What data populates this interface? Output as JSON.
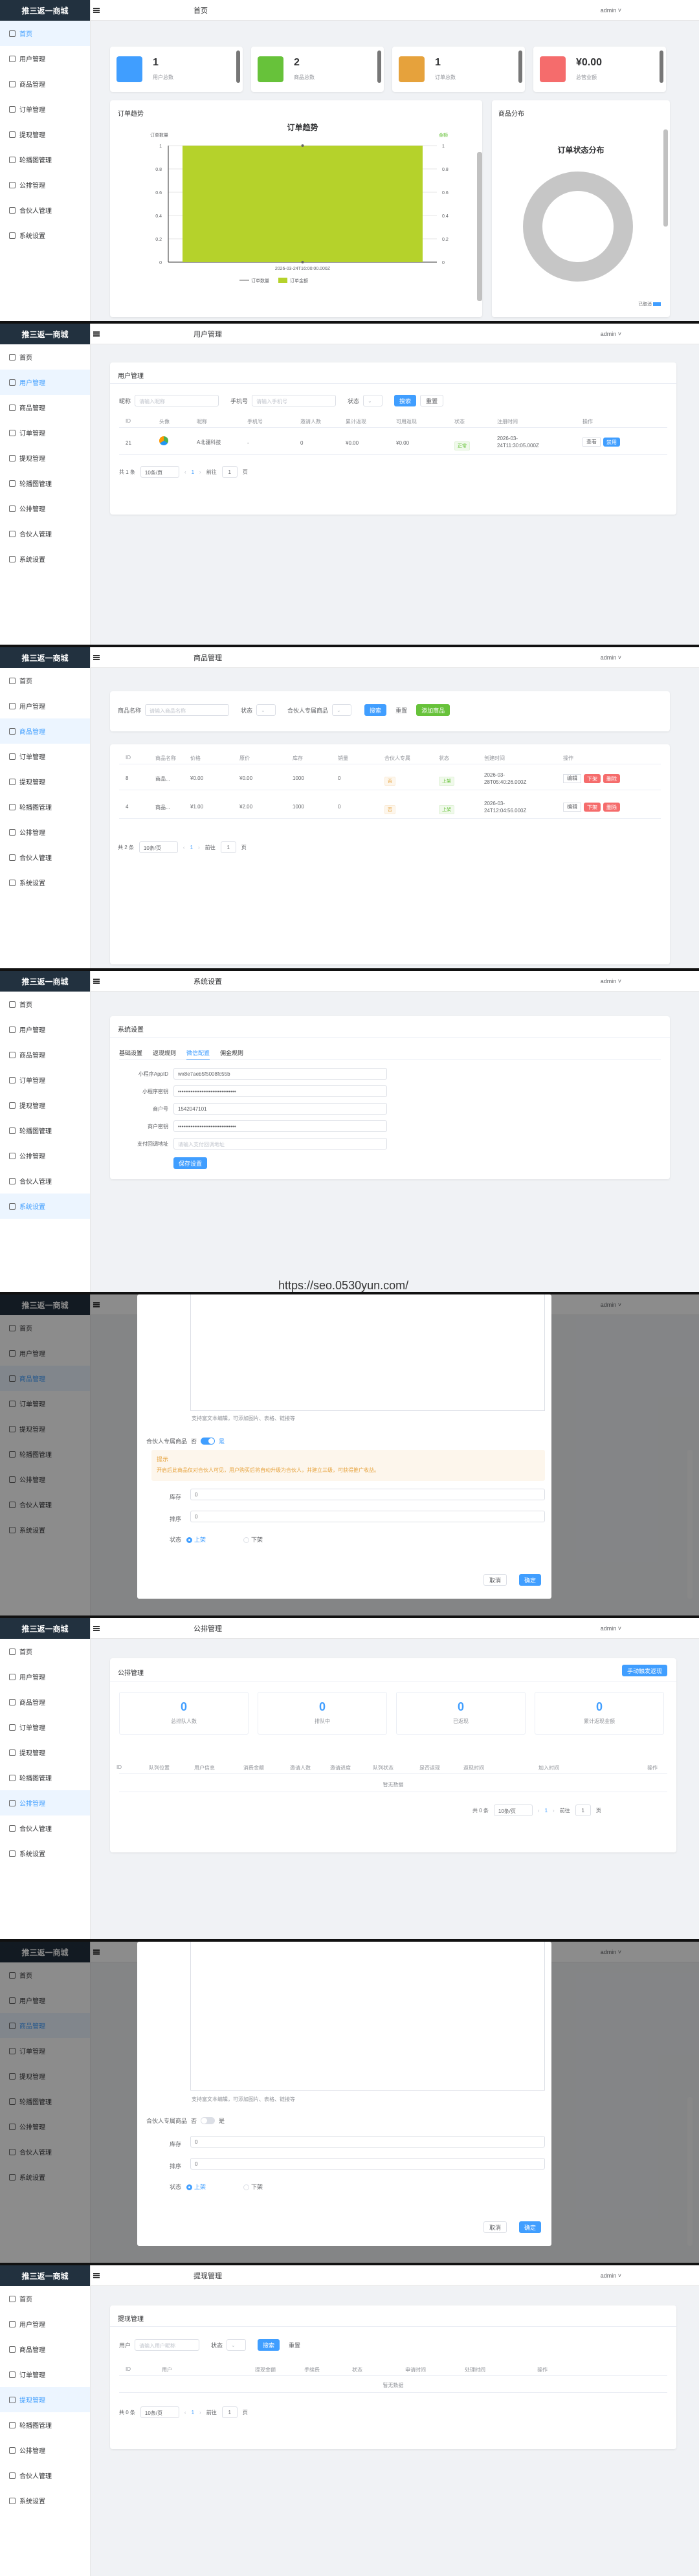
{
  "app": {
    "name": "推三返一商城",
    "user": "admin ˅"
  },
  "menu": [
    "首页",
    "用户管理",
    "商品管理",
    "订单管理",
    "提现管理",
    "轮播图管理",
    "公排管理",
    "合伙人管理",
    "系统设置"
  ],
  "s1": {
    "title": "首页",
    "stats": [
      {
        "value": "1",
        "label": "用户总数",
        "color": "#409eff"
      },
      {
        "value": "2",
        "label": "商品总数",
        "color": "#67c23a"
      },
      {
        "value": "1",
        "label": "订单总数",
        "color": "#e6a23c"
      },
      {
        "value": "¥0.00",
        "label": "总营业额",
        "color": "#f56c6c"
      }
    ],
    "trend_title": "订单趋势",
    "dist_title": "商品分布",
    "pie_title": "订单状态分布",
    "pie_legend": "已取消"
  },
  "chart_data": {
    "type": "bar",
    "title": "订单趋势",
    "categories": [
      "2026-03-24T16:00:00.000Z"
    ],
    "series": [
      {
        "name": "订单数量",
        "values": [
          1
        ]
      },
      {
        "name": "订单金额",
        "values": [
          0
        ]
      }
    ],
    "left_axis_label": "订单数量",
    "right_axis_label": "金额",
    "yticks": [
      "0",
      "0.2",
      "0.4",
      "0.6",
      "0.8",
      "1"
    ],
    "ylim": [
      0,
      1
    ]
  },
  "s2": {
    "title": "用户管理",
    "card_title": "用户管理",
    "filters": {
      "nick_label": "昵称",
      "nick_ph": "请输入昵称",
      "phone_label": "手机号",
      "phone_ph": "请输入手机号",
      "status_label": "状态",
      "search": "搜索",
      "reset": "重置"
    },
    "headers": [
      "ID",
      "头像",
      "昵称",
      "手机号",
      "邀请人数",
      "累计返现",
      "可用返现",
      "状态",
      "注册时间",
      "操作"
    ],
    "row": {
      "id": "21",
      "nick": "A北疆科技",
      "phone": "-",
      "invites": "0",
      "total": "¥0.00",
      "avail": "¥0.00",
      "status": "正常",
      "time": "2026-03-24T11:30:05.000Z",
      "op1": "查看",
      "op2": "禁用"
    },
    "pager": {
      "total": "共 1 条",
      "size": "10条/页",
      "page": "1",
      "goto": "前往",
      "gopage": "1",
      "unit": "页"
    }
  },
  "s3": {
    "title": "商品管理",
    "filters": {
      "name_label": "商品名称",
      "name_ph": "请输入商品名称",
      "status_label": "状态",
      "partner_label": "合伙人专属商品",
      "search": "搜索",
      "reset": "重置",
      "add": "添加商品"
    },
    "headers": [
      "ID",
      "商品名称",
      "价格",
      "原价",
      "库存",
      "销量",
      "合伙人专属",
      "状态",
      "创建时间",
      "操作"
    ],
    "rows": [
      {
        "id": "8",
        "name": "商品...",
        "price": "¥0.00",
        "orig": "¥0.00",
        "stock": "1000",
        "sales": "0",
        "partner": "否",
        "status": "上架",
        "time": "2026-03-28T05:40:26.000Z"
      },
      {
        "id": "4",
        "name": "商品...",
        "price": "¥1.00",
        "orig": "¥2.00",
        "stock": "1000",
        "sales": "0",
        "partner": "否",
        "status": "上架",
        "time": "2026-03-24T12:04:56.000Z"
      }
    ],
    "ops": [
      "编辑",
      "下架",
      "删除"
    ],
    "pager": {
      "total": "共 2 条",
      "size": "10条/页",
      "page": "1",
      "goto": "前往",
      "gopage": "1",
      "unit": "页"
    }
  },
  "s4": {
    "title": "系统设置",
    "card_title": "系统设置",
    "tabs": [
      "基础设置",
      "返现规则",
      "微信配置",
      "佣金规则"
    ],
    "fields": [
      {
        "label": "小程序AppID",
        "value": "wx8e7aeb5f5008fc55b"
      },
      {
        "label": "小程序密钥",
        "value": "••••••••••••••••••••••••••••••••"
      },
      {
        "label": "商户号",
        "value": "1542047101"
      },
      {
        "label": "商户密钥",
        "value": "••••••••••••••••••••••••••••••••"
      },
      {
        "label": "支付回调地址",
        "value": "请输入支付回调地址"
      }
    ],
    "save": "保存设置",
    "watermark": "https://seo.0530yun.com/"
  },
  "s5": {
    "hint": "支持富文本编辑，可添加图片、表格、链接等",
    "partner_label": "合伙人专属商品",
    "no": "否",
    "yes": "是",
    "notice_title": "提示",
    "notice_body": "开启后此商品仅对合伙人可见，用户购买后将自动升级为合伙人，并建立三级，可获得推广收益。",
    "stock_label": "库存",
    "stock": "0",
    "sort_label": "排序",
    "sort": "0",
    "status_label": "状态",
    "on": "上架",
    "off": "下架",
    "cancel": "取消",
    "ok": "确定"
  },
  "s6": {
    "title": "公排管理",
    "card_title": "公排管理",
    "button": "手动触发返现",
    "stats": [
      {
        "value": "0",
        "label": "总排队人数"
      },
      {
        "value": "0",
        "label": "排队中"
      },
      {
        "value": "0",
        "label": "已返现"
      },
      {
        "value": "0",
        "label": "累计返现金额"
      }
    ],
    "headers": [
      "ID",
      "队列位置",
      "用户信息",
      "消费金额",
      "邀请人数",
      "邀请进度",
      "队列状态",
      "是否返现",
      "返现时间",
      "加入时间",
      "操作"
    ],
    "empty": "暂无数据",
    "pager": {
      "total": "共 0 条",
      "size": "10条/页",
      "page": "1",
      "goto": "前往",
      "gopage": "1",
      "unit": "页"
    }
  },
  "s8": {
    "title": "提现管理",
    "card_title": "提现管理",
    "filters": {
      "user_label": "用户",
      "user_ph": "请输入用户昵称",
      "status_label": "状态",
      "search": "搜索",
      "reset": "重置"
    },
    "headers": [
      "ID",
      "用户",
      "提现金额",
      "手续费",
      "状态",
      "申请时间",
      "处理时间",
      "操作"
    ],
    "empty": "暂无数据",
    "pager": {
      "total": "共 0 条",
      "size": "10条/页",
      "page": "1",
      "goto": "前往",
      "gopage": "1",
      "unit": "页"
    }
  }
}
